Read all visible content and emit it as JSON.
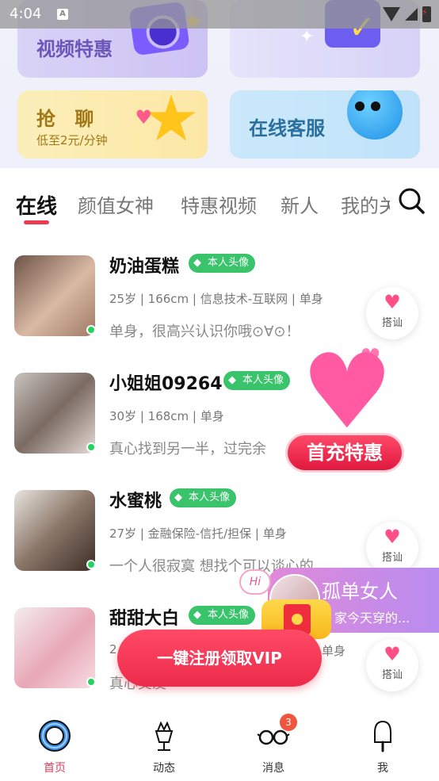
{
  "status_bar": {
    "time": "4:04"
  },
  "banner": {
    "video_label": "视频特惠",
    "chat_label": "抢 聊",
    "chat_sub": "低至2元/分钟",
    "service_label": "在线客服"
  },
  "tabs": [
    {
      "label": "在线"
    },
    {
      "label": "颜值女神"
    },
    {
      "label": "特惠视频"
    },
    {
      "label": "新人"
    },
    {
      "label": "我的关"
    }
  ],
  "users": [
    {
      "name": "奶油蛋糕",
      "badge": "本人头像",
      "meta": "25岁 | 166cm | 信息技术-互联网 | 单身",
      "bio": "单身，很高兴认识你哦⊙∀⊙！",
      "greet": "搭讪"
    },
    {
      "name": "小姐姐09264",
      "badge": "本人头像",
      "meta": "30岁 | 168cm | 单身",
      "bio": "真心找到另一半，过完余",
      "greet": "搭讪"
    },
    {
      "name": "水蜜桃",
      "badge": "本人头像",
      "meta": "27岁 | 金融保险-信托/担保 | 单身",
      "bio": "一个人很寂寞 想找个可以谈心的",
      "greet": "搭讪"
    },
    {
      "name": "甜甜大白",
      "badge": "本人头像",
      "meta": "2",
      "meta2": "单身",
      "bio": "真心交友",
      "greet": "搭讪"
    }
  ],
  "promo": {
    "label": "首充特惠"
  },
  "side_card": {
    "hi": "Hi",
    "title": "孤单女人",
    "text": "家今天穿的..."
  },
  "cta": {
    "label": "一键注册领取VIP"
  },
  "bottom_nav": [
    {
      "label": "首页",
      "icon": "home-lifebuoy-icon"
    },
    {
      "label": "动态",
      "icon": "ice-cream-trend-icon"
    },
    {
      "label": "消息",
      "icon": "glasses-message-icon",
      "badge": "3"
    },
    {
      "label": "我",
      "icon": "popsicle-profile-icon"
    }
  ],
  "colors": {
    "accent": "#ef3b4f",
    "badge_green": "#39c36b",
    "online": "#22d45f"
  }
}
